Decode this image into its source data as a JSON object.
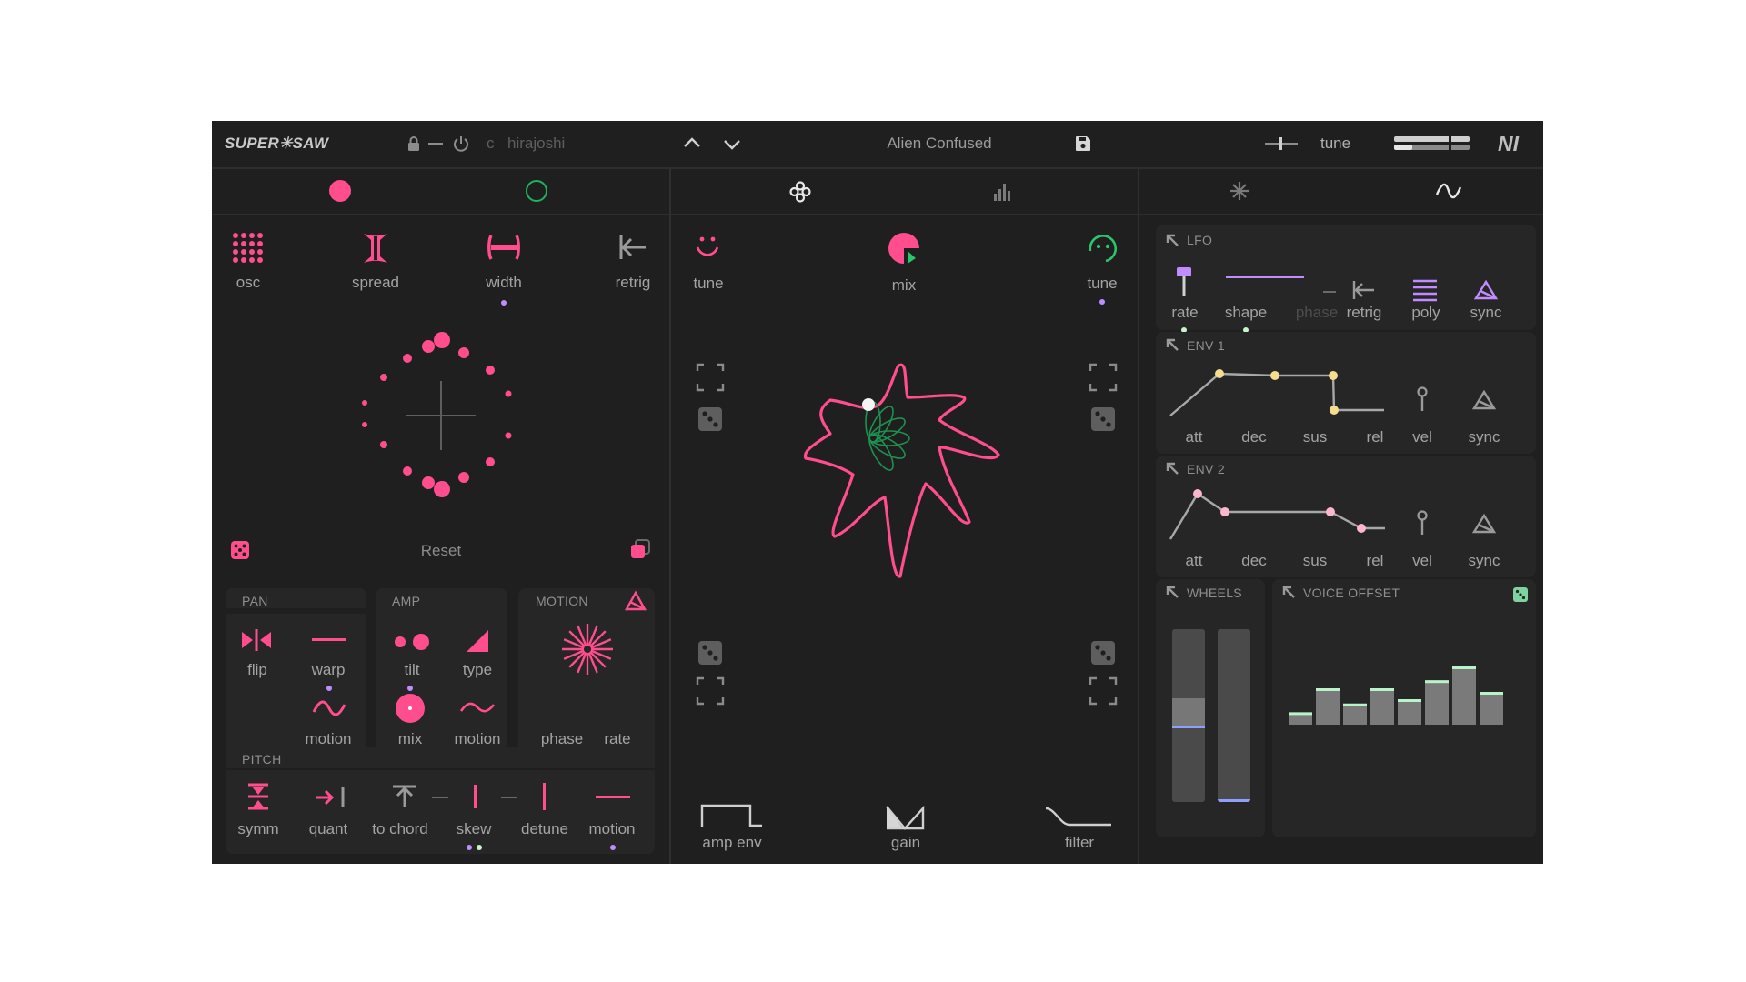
{
  "header": {
    "logo": "SUPER✳SAW",
    "key_root": "c",
    "scale": "hirajoshi",
    "preset_name": "Alien Confused",
    "tune_label": "tune",
    "brand": "NI"
  },
  "left": {
    "controls": {
      "osc": "osc",
      "spread": "spread",
      "width": "width",
      "retrig": "retrig"
    },
    "reset": "Reset",
    "pan": {
      "title": "PAN",
      "flip": "flip",
      "warp": "warp",
      "motion": "motion"
    },
    "amp": {
      "title": "AMP",
      "tilt": "tilt",
      "type": "type",
      "mix": "mix",
      "motion": "motion"
    },
    "motion": {
      "title": "MOTION",
      "phase": "phase",
      "rate": "rate"
    },
    "pitch": {
      "title": "PITCH",
      "symm": "symm",
      "quant": "quant",
      "to_chord": "to chord",
      "skew": "skew",
      "detune": "detune",
      "motion": "motion"
    }
  },
  "center": {
    "tune_left": "tune",
    "mix": "mix",
    "tune_right": "tune",
    "amp_env": "amp env",
    "gain": "gain",
    "filter": "filter"
  },
  "right": {
    "lfo": {
      "title": "LFO",
      "rate": "rate",
      "shape": "shape",
      "phase": "phase",
      "retrig": "retrig",
      "poly": "poly",
      "sync": "sync"
    },
    "env1": {
      "title": "ENV 1",
      "att": "att",
      "dec": "dec",
      "sus": "sus",
      "rel": "rel",
      "vel": "vel",
      "sync": "sync"
    },
    "env2": {
      "title": "ENV 2",
      "att": "att",
      "dec": "dec",
      "sus": "sus",
      "rel": "rel",
      "vel": "vel",
      "sync": "sync"
    },
    "wheels": {
      "title": "WHEELS",
      "levels": [
        0.35,
        0.0
      ]
    },
    "voice_offset": {
      "title": "VOICE OFFSET",
      "values": [
        0.17,
        0.5,
        0.29,
        0.5,
        0.35,
        0.61,
        0.8,
        0.45
      ]
    }
  },
  "colors": {
    "accent": "#ff4d8d",
    "lilac": "#c18cff",
    "green": "#2bc56b",
    "yellow": "#f4dd8c",
    "panel": "#1f1f1f",
    "wheel_line": "#8ea0ff"
  }
}
